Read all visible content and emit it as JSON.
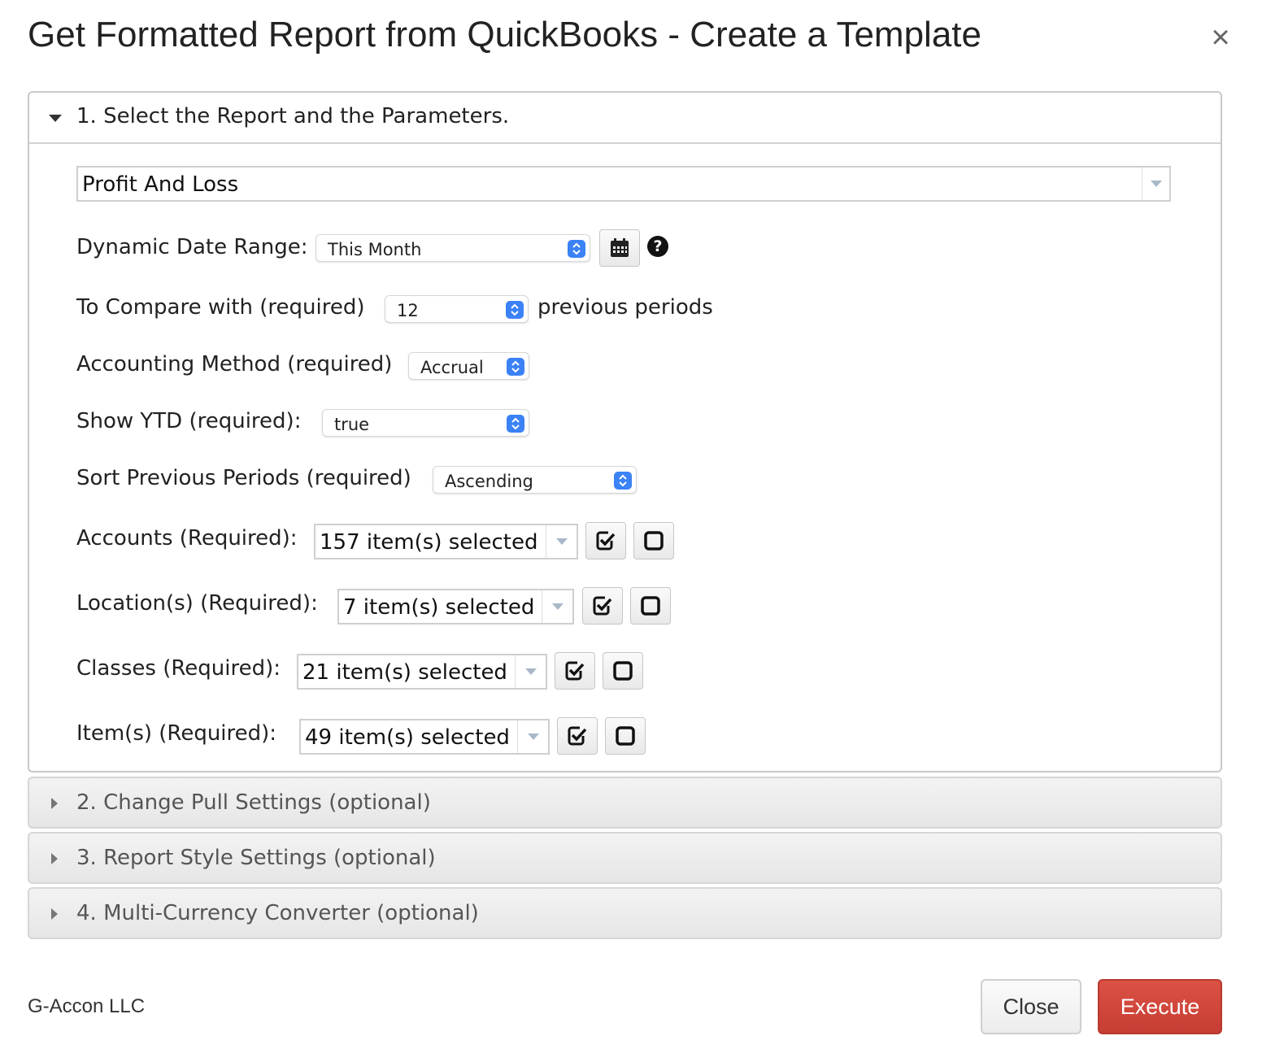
{
  "dialog": {
    "title": "Get Formatted Report from QuickBooks - Create a Template",
    "close_symbol": "×"
  },
  "section1": {
    "title": "1. Select the Report and the Parameters.",
    "report_value": "Profit And Loss",
    "date_range": {
      "label": "Dynamic Date Range:",
      "value": "This Month"
    },
    "compare": {
      "label": "To Compare with (required)",
      "value": "12",
      "suffix": "previous periods"
    },
    "accounting_method": {
      "label": "Accounting Method (required)",
      "value": "Accrual"
    },
    "show_ytd": {
      "label": "Show YTD (required):",
      "value": "true"
    },
    "sort_periods": {
      "label": "Sort Previous Periods (required)",
      "value": "Ascending"
    },
    "accounts": {
      "label": "Accounts (Required):",
      "value": "157 item(s) selected"
    },
    "locations": {
      "label": "Location(s) (Required):",
      "value": "7 item(s) selected"
    },
    "classes": {
      "label": "Classes (Required):",
      "value": "21 item(s) selected"
    },
    "items": {
      "label": "Item(s) (Required):",
      "value": "49 item(s) selected"
    },
    "help_symbol": "?"
  },
  "section2": {
    "title": "2. Change Pull Settings (optional)"
  },
  "section3": {
    "title": "3. Report Style Settings (optional)"
  },
  "section4": {
    "title": "4. Multi-Currency Converter (optional)"
  },
  "footer": {
    "brand": "G-Accon LLC",
    "close_label": "Close",
    "execute_label": "Execute"
  },
  "colors": {
    "execute": "#d14a3f",
    "stepper": "#3b82f6",
    "border": "#c9c9c9"
  }
}
